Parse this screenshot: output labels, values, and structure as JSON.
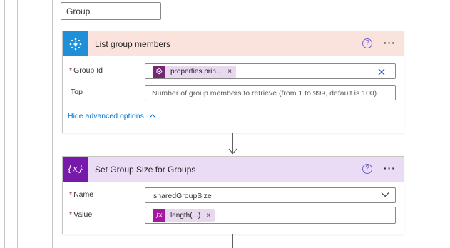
{
  "scope": {
    "label": "Group"
  },
  "action1": {
    "title": "List group members",
    "icon": "azure-ad-icon",
    "help_icon": "?",
    "more_icon": "···",
    "fields": [
      {
        "label": "Group Id",
        "required": true,
        "token": {
          "text": "properties.prin...",
          "icon": "dynamic-content-icon",
          "remove": "×"
        },
        "clear_icon": "×"
      },
      {
        "label": "Top",
        "required": false,
        "placeholder": "Number of group members to retrieve (from 1 to 999, default is 100)."
      }
    ],
    "advanced_link": "Hide advanced options"
  },
  "action2": {
    "title": "Set Group Size for Groups",
    "icon": "variable-icon",
    "icon_text": "{x}",
    "help_icon": "?",
    "more_icon": "···",
    "fields": [
      {
        "label": "Name",
        "required": true,
        "value": "sharedGroupSize"
      },
      {
        "label": "Value",
        "required": true,
        "token": {
          "text": "length(...)",
          "icon": "fx-icon",
          "icon_text": "fx",
          "remove": "×"
        }
      }
    ]
  },
  "colors": {
    "action1_header": "#fae2dd",
    "action1_icon": "#1f8fd8",
    "action2_header": "#e9dcf4",
    "action2_icon": "#7719aa",
    "link": "#0078d4",
    "required": "#a4262c"
  }
}
